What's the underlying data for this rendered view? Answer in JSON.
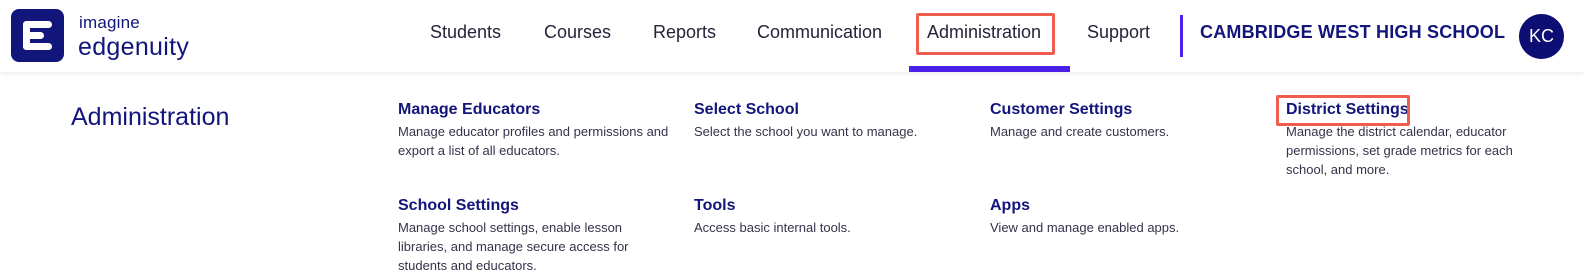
{
  "brand": {
    "line1": "imagine",
    "line2": "edgenuity",
    "color": "#12157a"
  },
  "nav": {
    "items": [
      {
        "label": "Students"
      },
      {
        "label": "Courses"
      },
      {
        "label": "Reports"
      },
      {
        "label": "Communication"
      },
      {
        "label": "Administration",
        "active": true
      },
      {
        "label": "Support"
      }
    ],
    "accent_color": "#4b21e8",
    "highlight_color": "#ef5d4f"
  },
  "school": {
    "name": "CAMBRIDGE WEST HIGH SCHOOL"
  },
  "user": {
    "initials": "KC"
  },
  "panel": {
    "title": "Administration",
    "items": [
      {
        "title": "Manage Educators",
        "desc": "Manage educator profiles and permissions and export a list of all educators."
      },
      {
        "title": "Select School",
        "desc": "Select the school you want to manage."
      },
      {
        "title": "Customer Settings",
        "desc": "Manage and create customers."
      },
      {
        "title": "District Settings",
        "desc": "Manage the district calendar, educator permissions, set grade metrics for each school, and more.",
        "highlighted": true
      },
      {
        "title": "School Settings",
        "desc": "Manage school settings, enable lesson libraries, and manage secure access for students and educators."
      },
      {
        "title": "Tools",
        "desc": "Access basic internal tools."
      },
      {
        "title": "Apps",
        "desc": "View and manage enabled apps."
      }
    ]
  }
}
